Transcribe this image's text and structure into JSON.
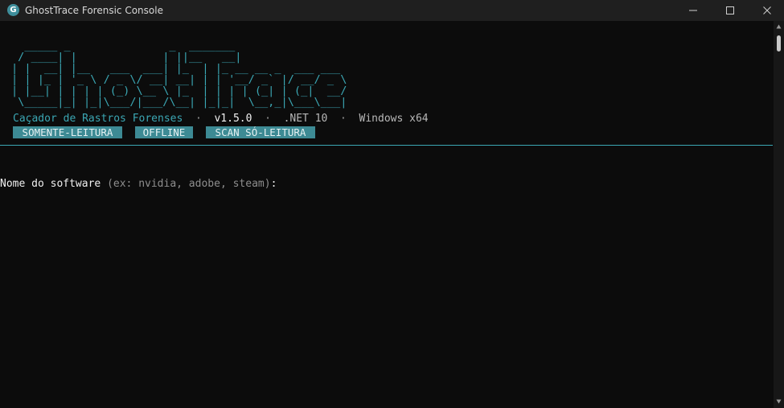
{
  "window": {
    "title": "GhostTrace Forensic Console",
    "app_icon_letter": "G",
    "controls": [
      "minimize-icon",
      "maximize-icon",
      "close-icon"
    ]
  },
  "banner": {
    "ascii_art": "  _____ _               _  _______\n / ____| |             | ||__   __|\n| |  __| |__   ___  ___| |_  | |_ __ __ _  ___ ___\n| | |_ | '_ \\ / _ \\/ __| __| | | '__/ _` |/ __/ _ \\\n| |__| | | | | (_) \\__ \\ |_  | | | | (_| | (_|  __/\n \\_____|_| |_|\\___/|___/\\__| |_|_|  \\__,_|\\___\\___|",
    "tagline": "Caçador de Rastros Forenses",
    "separator": "·",
    "version": "v1.5.0",
    "runtime": ".NET 10",
    "platform": "Windows x64"
  },
  "badges": [
    "SOMENTE-LEITURA",
    "OFFLINE",
    "SCAN SÓ-LEITURA"
  ],
  "prompt": {
    "label": "Nome do software",
    "hint": "(ex: nvidia, adobe, steam)",
    "colon": ":",
    "value": ""
  },
  "colors": {
    "accent": "#3ba7b4",
    "badge_bg": "#3d8a94",
    "background": "#0c0c0c",
    "titlebar": "#1f1f1f",
    "text": "#f0f0f0",
    "muted": "#8e8e8e"
  }
}
